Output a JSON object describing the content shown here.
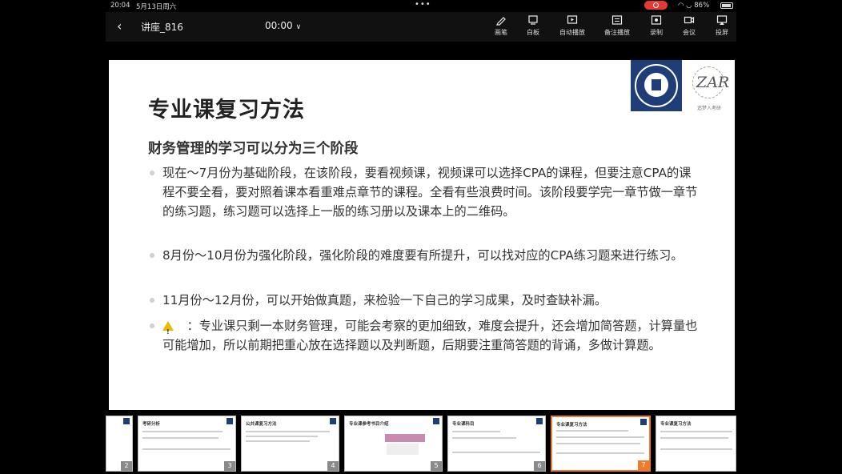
{
  "status_bar": {
    "time": "20:04",
    "date": "5月13日周六",
    "battery": "86%"
  },
  "toolbar": {
    "title": "讲座_816",
    "timer": "00:00",
    "tools": [
      {
        "label": "画笔",
        "icon": "pen-icon"
      },
      {
        "label": "白板",
        "icon": "whiteboard-icon"
      },
      {
        "label": "自动播放",
        "icon": "autoplay-icon"
      },
      {
        "label": "备注播放",
        "icon": "notes-play-icon"
      },
      {
        "label": "录制",
        "icon": "record-icon"
      },
      {
        "label": "会议",
        "icon": "meeting-icon"
      },
      {
        "label": "投屏",
        "icon": "cast-icon"
      }
    ]
  },
  "slide": {
    "title": "专业课复习方法",
    "subtitle": "财务管理的学习可以分为三个阶段",
    "bullets": [
      "现在～7月份为基础阶段，在该阶段，要看视频课，视频课可以选择CPA的课程，但要注意CPA的课程不要全看，要对照着课本看重难点章节的课程。全看有些浪费时间。该阶段要学完一章节做一章节的练习题，练习题可以选择上一版的练习册以及课本上的二维码。",
      "8月份～10月份为强化阶段，强化阶段的难度要有所提升，可以找对应的CPA练习题来进行练习。",
      "11月份～12月份，可以开始做真题，来检验一下自己的学习成果，及时查缺补漏。",
      "：专业课只剩一本财务管理，可能会考察的更加细致，难度会提升，还会增加简答题，计算量也可能增加，所以前期把重心放在选择题以及判断题，后期要注重简答题的背诵，多做计算题。"
    ],
    "logo_caption": "追梦人考研"
  },
  "thumbnails": [
    {
      "num": "2",
      "title": ""
    },
    {
      "num": "3",
      "title": "考研分析"
    },
    {
      "num": "4",
      "title": "公共课复习方法"
    },
    {
      "num": "5",
      "title": "专业课参考书目介绍"
    },
    {
      "num": "6",
      "title": "专业课科目"
    },
    {
      "num": "7",
      "title": "专业课复习方法",
      "active": true
    },
    {
      "num": "",
      "title": "专业课复习方法"
    }
  ]
}
